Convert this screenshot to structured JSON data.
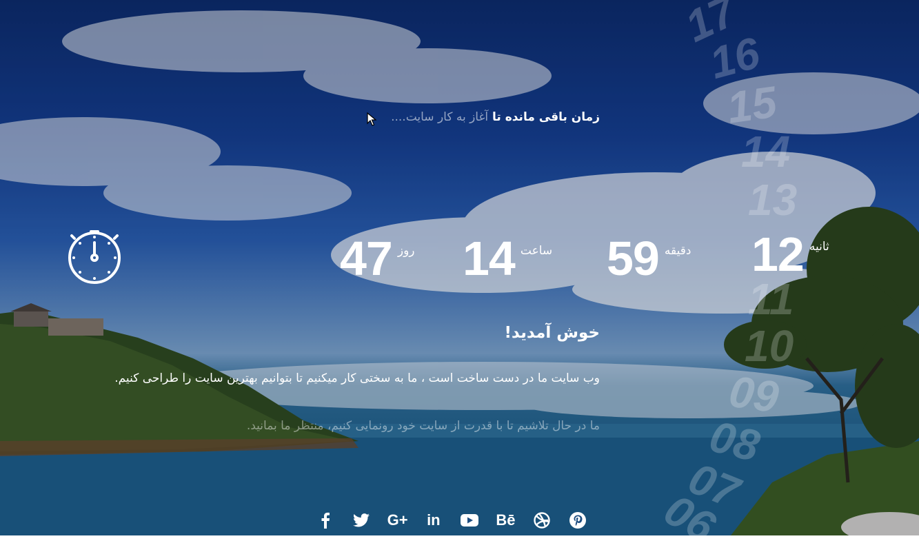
{
  "countdown": {
    "headline_main": "زمان باقی مانده تا",
    "headline_muted": "آغاز به کار سایت....",
    "days": {
      "value": "47",
      "label": "روز"
    },
    "hours": {
      "value": "14",
      "label": "ساعت"
    },
    "minutes": {
      "value": "59",
      "label": "دقیقه"
    },
    "seconds": {
      "value": "12",
      "label": "ثانیه"
    }
  },
  "rolling_numbers": [
    "17",
    "16",
    "15",
    "14",
    "13",
    "11",
    "10",
    "09",
    "08",
    "07",
    "06"
  ],
  "welcome": {
    "title": "خوش آمدید!",
    "description": "وب سایت ما در دست ساخت است ، ما به سختی کار میکنیم تا بتوانیم بهترین سایت را طراحی کنیم.",
    "subtitle": "ما در حال تلاشیم تا با قدرت از سایت خود رونمایی کنیم، منتظر ما بمانید."
  },
  "social": [
    {
      "name": "facebook-icon",
      "glyph": "f"
    },
    {
      "name": "twitter-icon",
      "glyph": ""
    },
    {
      "name": "google-plus-icon",
      "glyph": "G+"
    },
    {
      "name": "linkedin-icon",
      "glyph": "in"
    },
    {
      "name": "youtube-icon",
      "glyph": ""
    },
    {
      "name": "behance-icon",
      "glyph": "Bē"
    },
    {
      "name": "dribbble-icon",
      "glyph": ""
    },
    {
      "name": "pinterest-icon",
      "glyph": ""
    }
  ],
  "colors": {
    "text": "#ffffff",
    "sky": "#143d8f",
    "sea": "#1f5f88"
  }
}
